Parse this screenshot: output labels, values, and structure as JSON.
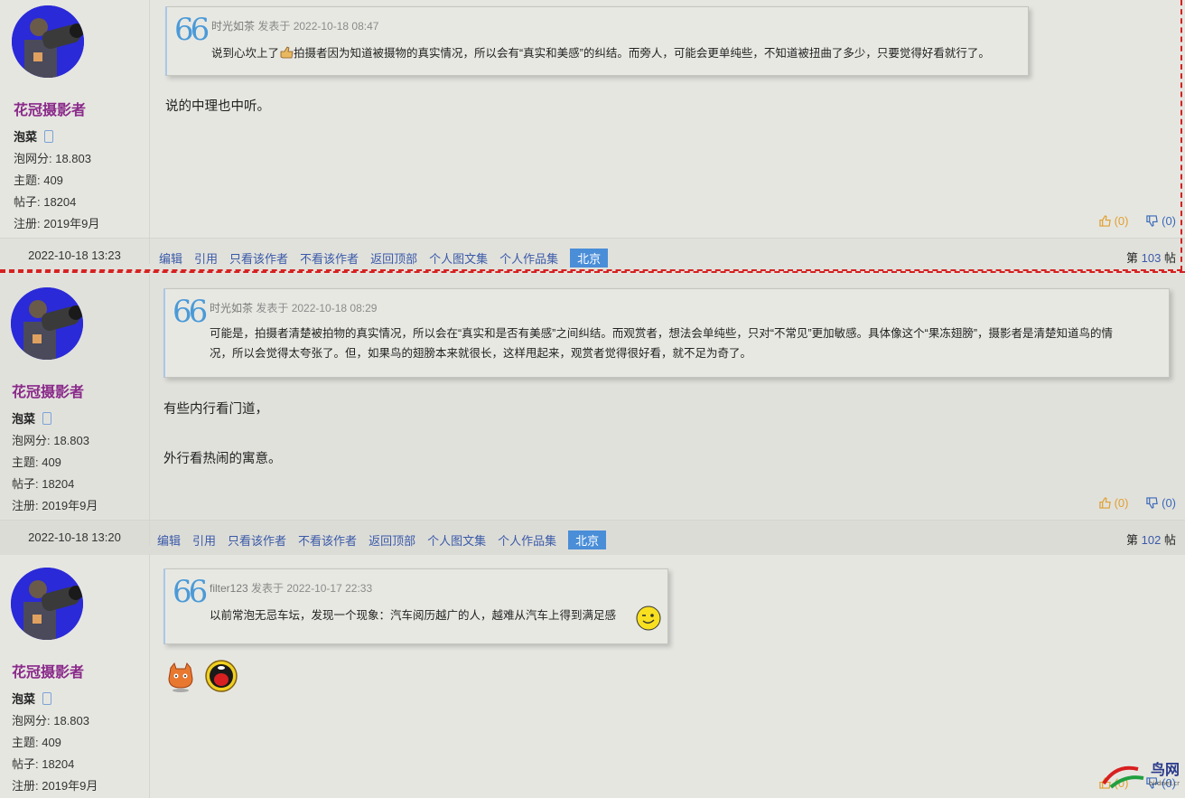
{
  "posts": [
    {
      "username": "花冠摄影者",
      "level": "泡菜",
      "score": "泡网分: 18.803",
      "topics": "主题: 409",
      "posts_count": "帖子: 18204",
      "registered": "注册: 2019年9月",
      "quote_author": "时光如茶",
      "quote_meta": "发表于 2022-10-18 08:47",
      "quote_lines": [
        "说到心坎上了",
        "拍摄者因为知道被摄物的真实情况，所以会有“真实和美感”的纠结。而旁人，可能会更单纯些，不知道被扭曲了多少，只要觉得好看就行了。"
      ],
      "body": [
        "说的中理也中听。"
      ],
      "likes": "(0)",
      "dislikes": "(0)",
      "time": "2022-10-18 13:23",
      "floor_prefix": "第",
      "floor_num": "103",
      "floor_suffix": "帖"
    },
    {
      "username": "花冠摄影者",
      "level": "泡菜",
      "score": "泡网分: 18.803",
      "topics": "主题: 409",
      "posts_count": "帖子: 18204",
      "registered": "注册: 2019年9月",
      "quote_author": "时光如茶",
      "quote_meta": "发表于 2022-10-18 08:29",
      "quote_lines": [
        "可能是，拍摄者清楚被拍物的真实情况，所以会在“真实和是否有美感”之间纠结。而观赏者，想法会单纯些，只对“不常见”更加敏感。具体像这个“果冻翅膀”，摄影者是清楚知道鸟的情",
        "况，所以会觉得太夸张了。但，如果鸟的翅膀本来就很长，这样甩起来，观赏者觉得很好看，就不足为奇了。"
      ],
      "body": [
        "有些内行看门道，",
        "外行看热闹的寓意。"
      ],
      "likes": "(0)",
      "dislikes": "(0)",
      "time": "2022-10-18 13:20",
      "floor_prefix": "第",
      "floor_num": "102",
      "floor_suffix": "帖"
    },
    {
      "username": "花冠摄影者",
      "level": "泡菜",
      "score": "泡网分: 18.803",
      "topics": "主题: 409",
      "posts_count": "帖子: 18204",
      "registered": "注册: 2019年9月",
      "quote_author": "filter123",
      "quote_meta": "发表于 2022-10-17 22:33",
      "quote_lines": [
        "以前常泡无忌车坛，发现一个现象：汽车阅历越广的人，越难从汽车上得到满足感"
      ],
      "likes": "(0)",
      "dislikes": "(0)"
    }
  ],
  "actions": [
    "编辑",
    "引用",
    "只看该作者",
    "不看该作者",
    "返回顶部",
    "个人图文集",
    "个人作品集"
  ],
  "location": "北京",
  "watermark": "鸟网",
  "watermark_sub": "birdnet.cn"
}
